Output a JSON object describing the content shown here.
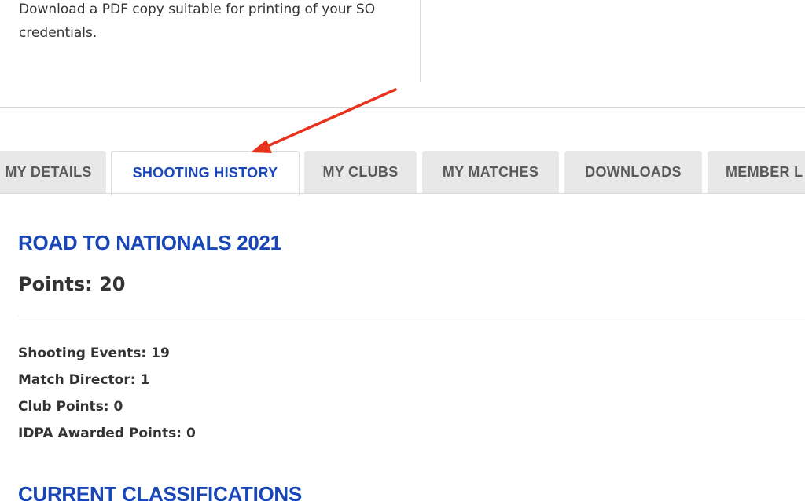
{
  "top_card": {
    "description": "Download a PDF copy suitable for printing of your SO credentials."
  },
  "tabs": [
    {
      "label": "MY DETAILS",
      "active": false
    },
    {
      "label": "SHOOTING HISTORY",
      "active": true
    },
    {
      "label": "MY CLUBS",
      "active": false
    },
    {
      "label": "MY MATCHES",
      "active": false
    },
    {
      "label": "DOWNLOADS",
      "active": false
    },
    {
      "label": "MEMBER L",
      "active": false
    }
  ],
  "road_to_nationals": {
    "title": "ROAD TO NATIONALS 2021",
    "points_label": "Points: 20",
    "stats": [
      "Shooting Events: 19",
      "Match Director: 1",
      "Club Points: 0",
      "IDPA Awarded Points: 0"
    ]
  },
  "current_classifications": {
    "title": "CURRENT CLASSIFICATIONS"
  },
  "colors": {
    "accent_blue": "#1a47b8",
    "tab_inactive_bg": "#e8e8e8",
    "annotation_red": "#e8321e"
  },
  "annotation": {
    "icon": "red-arrow-icon"
  }
}
